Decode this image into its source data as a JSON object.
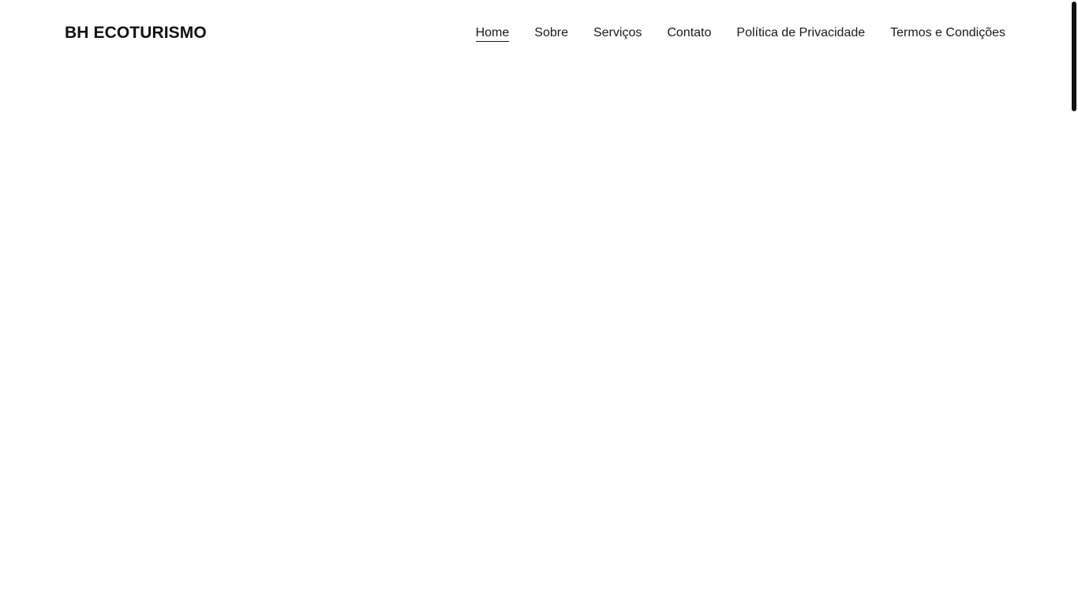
{
  "header": {
    "brand": "BH ECOTURISMO",
    "nav": [
      {
        "label": "Home",
        "active": true
      },
      {
        "label": "Sobre",
        "active": false
      },
      {
        "label": "Serviços",
        "active": false
      },
      {
        "label": "Contato",
        "active": false
      },
      {
        "label": "Política de Privacidade",
        "active": false
      },
      {
        "label": "Termos e Condições",
        "active": false
      }
    ]
  },
  "scroll": {
    "position_fraction": 0.0
  },
  "colors": {
    "background": "#ffffff",
    "text": "#111111",
    "scrollbar_thumb": "#111111"
  }
}
